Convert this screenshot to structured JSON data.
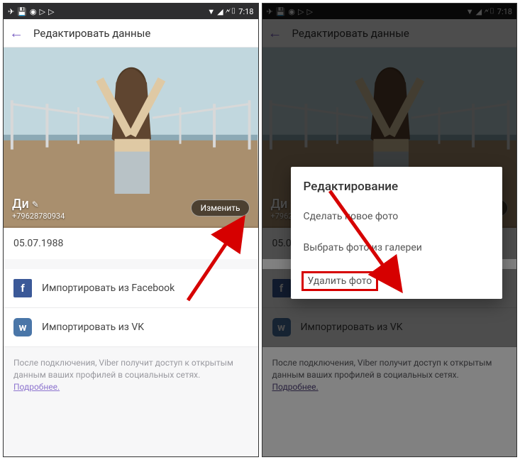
{
  "status": {
    "time": "7:18"
  },
  "appbar": {
    "title": "Редактировать данные"
  },
  "profile": {
    "name": "Ди",
    "phone": "+79628780934",
    "change_btn": "Изменить",
    "change_btn_short": "енить",
    "birthday": "05.07.1988"
  },
  "import": {
    "fb_label": "Импортировать из Facebook",
    "vk_label": "Импортировать из VK"
  },
  "note": {
    "text": "После подключения, Viber получит доступ к открытым данным ваших профилей в социальных сетях. ",
    "more": "Подробнее."
  },
  "dialog": {
    "title": "Редактирование",
    "opt_new": "Сделать новое фото",
    "opt_gallery": "Выбрать фото из галереи",
    "opt_delete": "Удалить фото"
  }
}
